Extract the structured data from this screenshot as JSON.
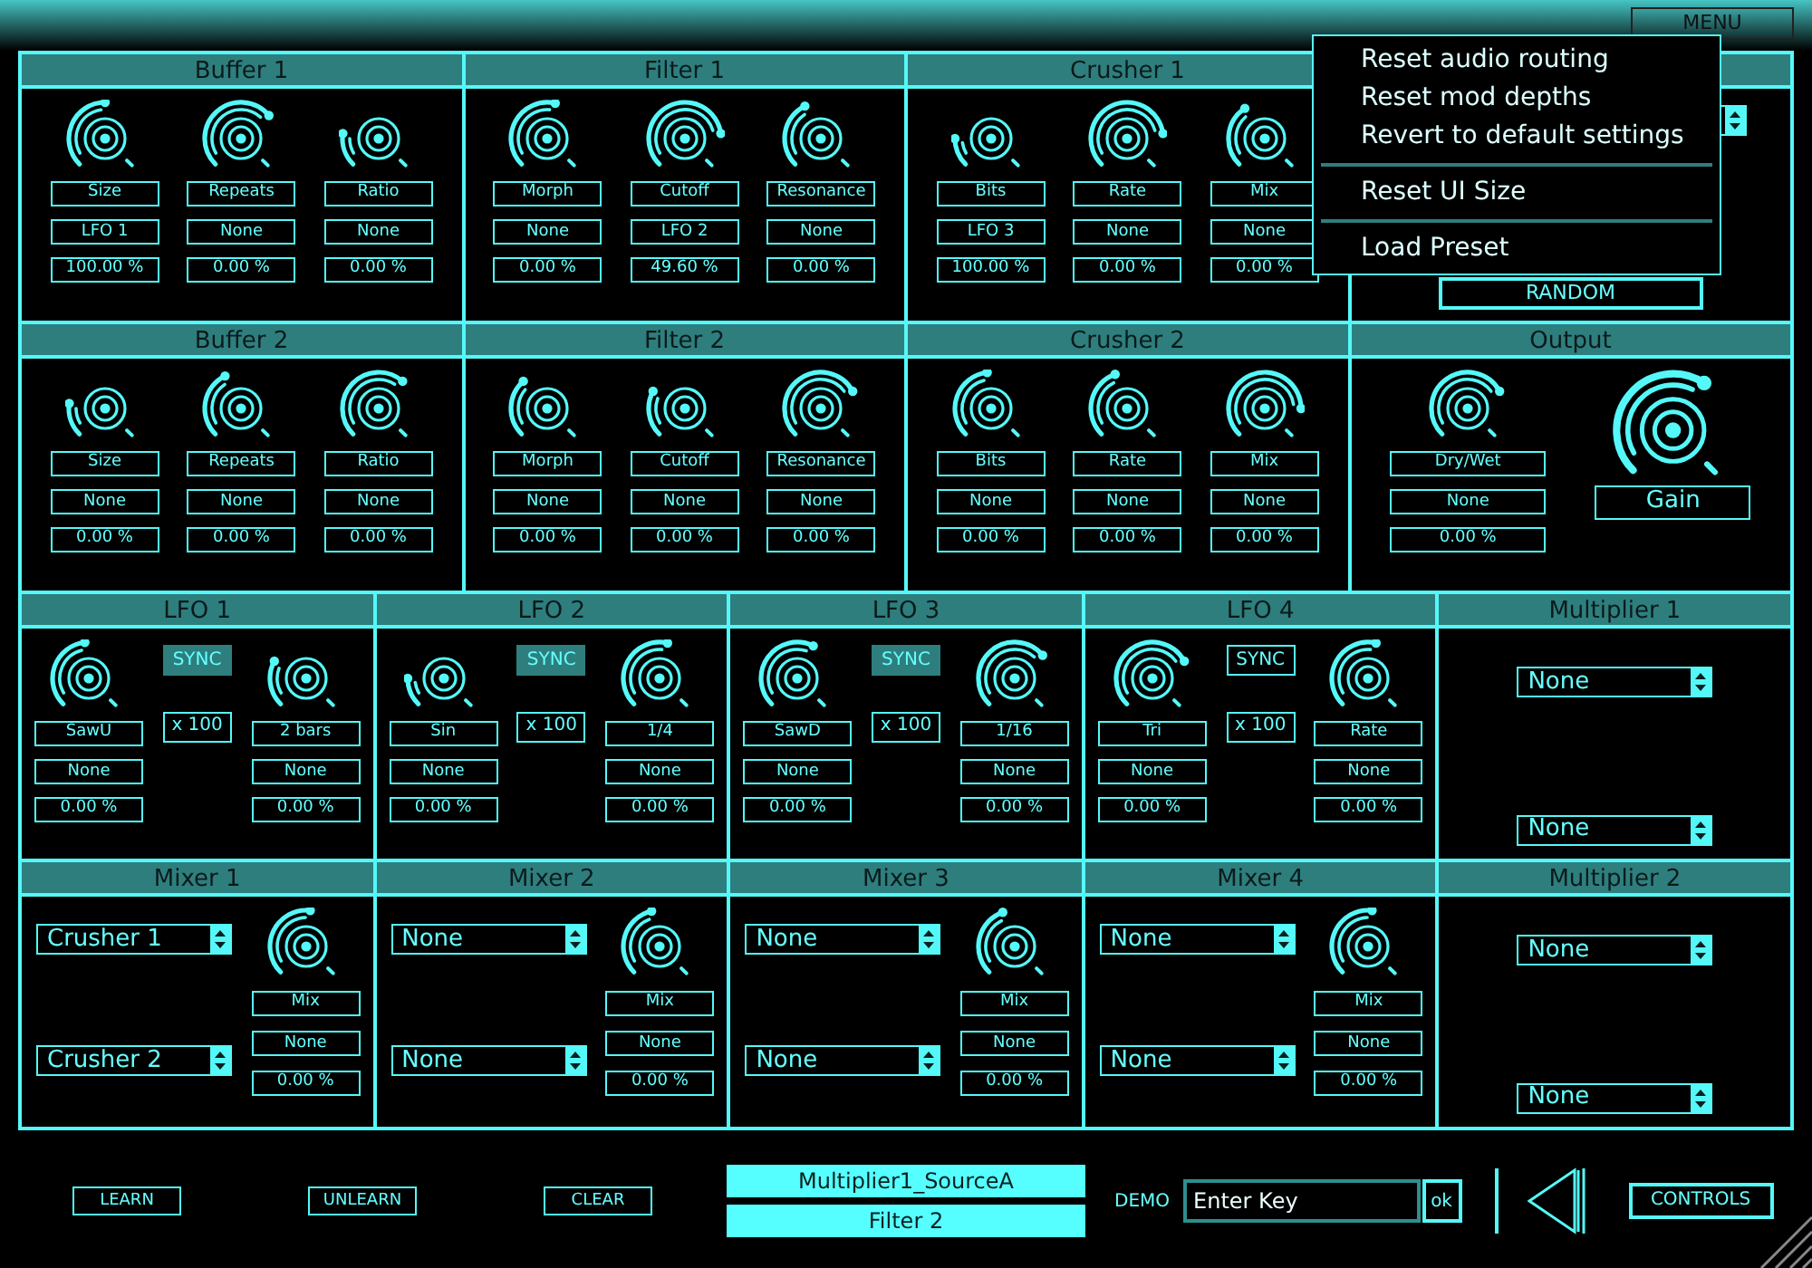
{
  "menu_button": "MENU",
  "menu": {
    "items": [
      {
        "label": "Reset audio routing",
        "separator_before": false
      },
      {
        "label": "Reset mod depths",
        "separator_before": false
      },
      {
        "label": "Revert to default settings",
        "separator_before": false
      },
      {
        "label": "Reset UI Size",
        "separator_before": true
      },
      {
        "label": "Load Preset",
        "separator_before": true
      }
    ]
  },
  "rows": [
    {
      "panels": [
        {
          "kind": "knobs",
          "title": "Buffer 1",
          "knobs": [
            {
              "label": "Size",
              "source": "LFO 1",
              "amount": "100.00 %",
              "level": 0.5
            },
            {
              "label": "Repeats",
              "source": "None",
              "amount": "0.00 %",
              "level": 0.85
            },
            {
              "label": "Ratio",
              "source": "None",
              "amount": "0.00 %",
              "level": 0.05
            }
          ]
        },
        {
          "kind": "knobs",
          "title": "Filter 1",
          "knobs": [
            {
              "label": "Morph",
              "source": "None",
              "amount": "0.00 %",
              "level": 0.6
            },
            {
              "label": "Cutoff",
              "source": "LFO 2",
              "amount": "49.60 %",
              "level": 0.95
            },
            {
              "label": "Resonance",
              "source": "None",
              "amount": "0.00 %",
              "level": 0.3
            }
          ]
        },
        {
          "kind": "knobs",
          "title": "Crusher 1",
          "knobs": [
            {
              "label": "Bits",
              "source": "LFO 3",
              "amount": "100.00 %",
              "level": 0
            },
            {
              "label": "Rate",
              "source": "None",
              "amount": "0.00 %",
              "level": 0.95
            },
            {
              "label": "Mix",
              "source": "None",
              "amount": "0.00 %",
              "level": 0.25
            }
          ]
        },
        {
          "kind": "random",
          "button": "RANDOM"
        }
      ]
    },
    {
      "panels": [
        {
          "kind": "knobs",
          "title": "Buffer 2",
          "knobs": [
            {
              "label": "Size",
              "source": "None",
              "amount": "0.00 %",
              "level": 0.05
            },
            {
              "label": "Repeats",
              "source": "None",
              "amount": "0.00 %",
              "level": 0.3
            },
            {
              "label": "Ratio",
              "source": "None",
              "amount": "0.00 %",
              "level": 0.8
            }
          ]
        },
        {
          "kind": "knobs",
          "title": "Filter 2",
          "knobs": [
            {
              "label": "Morph",
              "source": "None",
              "amount": "0.00 %",
              "level": 0.2
            },
            {
              "label": "Cutoff",
              "source": "None",
              "amount": "0.00 %",
              "level": 0.1
            },
            {
              "label": "Resonance",
              "source": "None",
              "amount": "0.00 %",
              "level": 0.9
            }
          ]
        },
        {
          "kind": "knobs",
          "title": "Crusher 2",
          "knobs": [
            {
              "label": "Bits",
              "source": "None",
              "amount": "0.00 %",
              "level": 0.45
            },
            {
              "label": "Rate",
              "source": "None",
              "amount": "0.00 %",
              "level": 0.35
            },
            {
              "label": "Mix",
              "source": "None",
              "amount": "0.00 %",
              "level": 1
            }
          ]
        },
        {
          "kind": "output",
          "title": "Output",
          "knobs": [
            {
              "label": "Dry/Wet",
              "source": "None",
              "amount": "0.00 %",
              "level": 0.9
            }
          ],
          "gain": {
            "label": "Gain",
            "level": 0.75
          }
        }
      ]
    },
    {
      "panels": [
        {
          "kind": "lfo",
          "title": "LFO 1",
          "shape_knob": {
            "label": "SawU",
            "source": "None",
            "amount": "0.00 %",
            "level": 0.45
          },
          "sync": {
            "label": "SYNC",
            "selected": true
          },
          "multiplier": "x 100",
          "rate_knob": {
            "label": "2 bars",
            "source": "None",
            "amount": "0.00 %",
            "level": 0.1
          }
        },
        {
          "kind": "lfo",
          "title": "LFO 2",
          "shape_knob": {
            "label": "Sin",
            "source": "None",
            "amount": "0.00 %",
            "level": 0
          },
          "sync": {
            "label": "SYNC",
            "selected": true
          },
          "multiplier": "x 100",
          "rate_knob": {
            "label": "1/4",
            "source": "None",
            "amount": "0.00 %",
            "level": 0.6
          }
        },
        {
          "kind": "lfo",
          "title": "LFO 3",
          "shape_knob": {
            "label": "SawD",
            "source": "None",
            "amount": "0.00 %",
            "level": 0.7
          },
          "sync": {
            "label": "SYNC",
            "selected": true
          },
          "multiplier": "x 100",
          "rate_knob": {
            "label": "1/16",
            "source": "None",
            "amount": "0.00 %",
            "level": 0.85
          }
        },
        {
          "kind": "lfo",
          "title": "LFO 4",
          "shape_knob": {
            "label": "Tri",
            "source": "None",
            "amount": "0.00 %",
            "level": 0.9
          },
          "sync": {
            "label": "SYNC",
            "selected": false
          },
          "multiplier": "x 100",
          "rate_knob": {
            "label": "Rate",
            "source": "None",
            "amount": "0.00 %",
            "level": 0.6
          }
        },
        {
          "kind": "multiplier",
          "title": "Multiplier 1",
          "selects": [
            "None",
            "None"
          ]
        }
      ]
    },
    {
      "panels": [
        {
          "kind": "mixer",
          "title": "Mixer 1",
          "selects": [
            "Crusher 1",
            "Crusher 2"
          ],
          "knob": {
            "label": "Mix",
            "source": "None",
            "amount": "0.00 %",
            "level": 0.55
          }
        },
        {
          "kind": "mixer",
          "title": "Mixer 2",
          "selects": [
            "None",
            "None"
          ],
          "knob": {
            "label": "Mix",
            "source": "None",
            "amount": "0.00 %",
            "level": 0.4
          }
        },
        {
          "kind": "mixer",
          "title": "Mixer 3",
          "selects": [
            "None",
            "None"
          ],
          "knob": {
            "label": "Mix",
            "source": "None",
            "amount": "0.00 %",
            "level": 0.35
          }
        },
        {
          "kind": "mixer",
          "title": "Mixer 4",
          "selects": [
            "None",
            "None"
          ],
          "knob": {
            "label": "Mix",
            "source": "None",
            "amount": "0.00 %",
            "level": 0.55
          }
        },
        {
          "kind": "multiplier",
          "title": "Multiplier 2",
          "selects": [
            "None",
            "None"
          ]
        }
      ]
    }
  ],
  "bottom": {
    "buttons": [
      "LEARN",
      "UNLEARN",
      "CLEAR"
    ],
    "status": [
      "Multiplier1_SourceA",
      "Filter 2"
    ],
    "demo_label": "DEMO",
    "key_field": {
      "value": "Enter Key"
    },
    "ok_button": "ok",
    "controls_button": "CONTROLS"
  }
}
